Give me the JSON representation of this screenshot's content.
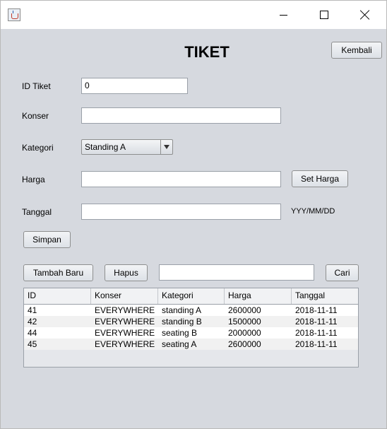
{
  "window": {
    "controls": [
      "minimize",
      "maximize",
      "close"
    ]
  },
  "form": {
    "title": "TIKET",
    "back_label": "Kembali",
    "id_label": "ID Tiket",
    "id_value": "0",
    "konser_label": "Konser",
    "konser_value": "",
    "kategori_label": "Kategori",
    "kategori_value": "Standing A",
    "harga_label": "Harga",
    "harga_value": "",
    "set_harga_label": "Set Harga",
    "tanggal_label": "Tanggal",
    "tanggal_value": "",
    "tanggal_hint": "YYY/MM/DD",
    "simpan_label": "Simpan"
  },
  "actions": {
    "tambah_label": "Tambah Baru",
    "hapus_label": "Hapus",
    "search_value": "",
    "cari_label": "Cari"
  },
  "table": {
    "columns": [
      "ID",
      "Konser",
      "Kategori",
      "Harga",
      "Tanggal"
    ],
    "rows": [
      [
        "41",
        "EVERYWHERE",
        "standing A",
        "2600000",
        "2018-11-11"
      ],
      [
        "42",
        "EVERYWHERE",
        "standing B",
        "1500000",
        "2018-11-11"
      ],
      [
        "44",
        "EVERYWHERE",
        "seating B",
        "2000000",
        "2018-11-11"
      ],
      [
        "45",
        "EVERYWHERE",
        "seating A",
        "2600000",
        "2018-11-11"
      ]
    ]
  }
}
